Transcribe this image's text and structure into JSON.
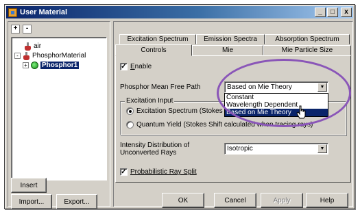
{
  "window": {
    "title": "User Material",
    "controls": {
      "minimize": "_",
      "maximize": "□",
      "close": "x"
    }
  },
  "tree": {
    "collapse_all": "+",
    "expand_all": "-",
    "items": [
      {
        "label": "air",
        "icon": "flask-icon"
      },
      {
        "label": "PhosphorMaterial",
        "icon": "flask-icon",
        "expander": "-"
      },
      {
        "label": "Phosphor1",
        "icon": "phosphor-icon",
        "expander": "+",
        "selected": true
      }
    ]
  },
  "left_buttons": {
    "insert": "Insert",
    "import": "Import...",
    "export": "Export..."
  },
  "tabs": {
    "row1": [
      "Excitation Spectrum",
      "Emission Spectra",
      "Absorption Spectrum"
    ],
    "row2": [
      "Controls",
      "Mie",
      "Mie Particle Size"
    ],
    "active": "Controls"
  },
  "controls": {
    "enable": {
      "label_prefix": "",
      "label_accel": "E",
      "label_rest": "nable",
      "checked": true,
      "mark": "✓"
    },
    "mean_free_path": {
      "label": "Phosphor Mean Free Path",
      "value": "Based on Mie Theory",
      "options": [
        "Constant",
        "Wavelength Dependent",
        "Based on Mie Theory"
      ],
      "selected_index": 2
    },
    "excitation_input": {
      "title": "Excitation Input",
      "option1": "Excitation Spectrum (Stokes",
      "option2": "Quantum Yield (Stokes Shift calculated when tracing rays)",
      "selected": 1
    },
    "intensity_distribution": {
      "label_line1": "Intensity Distribution of",
      "label_line2": "Unconverted Rays",
      "value": "Isotropic"
    },
    "probabilistic_split": {
      "label": "Probabilistic Ray Split",
      "checked": true,
      "mark": "✓"
    }
  },
  "bottom_buttons": {
    "ok": "OK",
    "cancel": "Cancel",
    "apply": "Apply",
    "help": "Help"
  },
  "colors": {
    "highlight": "#0a246a",
    "annotation": "#8a56b8",
    "face": "#d4d0c8"
  }
}
